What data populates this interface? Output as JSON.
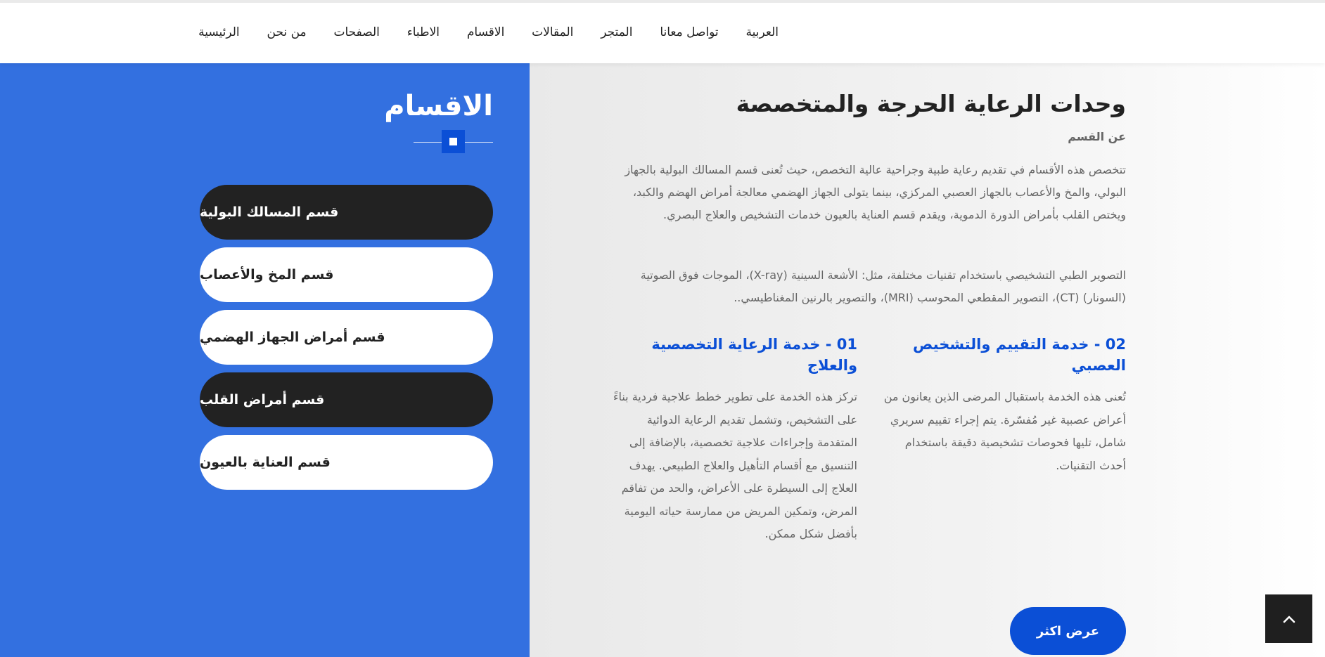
{
  "nav": {
    "items": [
      "الرئيسية",
      "من نحن",
      "الصفحات",
      "الاطباء",
      "الاقسام",
      "المقالات",
      "المتجر",
      "تواصل معانا",
      "العربية"
    ]
  },
  "sidebar": {
    "title": "الاقسام",
    "departments": [
      {
        "label": "قسم المسالك البولية",
        "style": "dark"
      },
      {
        "label": "قسم المخ والأعصاب",
        "style": "light"
      },
      {
        "label": "قسم أمراض الجهاز الهضمي",
        "style": "light"
      },
      {
        "label": "قسم أمراض القلب",
        "style": "dark"
      },
      {
        "label": "قسم العناية بالعيون",
        "style": "light"
      }
    ]
  },
  "main": {
    "title": "وحدات الرعاية الحرجة والمتخصصة",
    "subtitle": "عن القسم",
    "paragraph1": "تتخصص هذه الأقسام في تقديم رعاية طبية وجراحية عالية التخصص، حيث تُعنى قسم المسالك البولية بالجهاز البولي، والمخ والأعصاب بالجهاز العصبي المركزي، بينما يتولى الجهاز الهضمي معالجة أمراض الهضم والكبد، ويختص القلب بأمراض الدورة الدموية، ويقدم قسم العناية بالعيون خدمات التشخيص والعلاج البصري.",
    "paragraph2": "التصوير الطبي التشخيصي باستخدام تقنيات مختلفة، مثل: الأشعة السينية (X-ray)، الموجات فوق الصوتية (السونار) (CT)، التصوير المقطعي المحوسب (MRI)، والتصوير بالرنين المغناطيسي..",
    "services": [
      {
        "title": "02 - خدمة التقييم والتشخيص العصبي",
        "text": "تُعنى هذه الخدمة باستقبال المرضى الذين يعانون من أعراض عصبية غير مُفسّرة. يتم إجراء تقييم سريري شامل، تليها فحوصات تشخيصية دقيقة باستخدام أحدث التقنيات."
      },
      {
        "title": "01 - خدمة الرعاية التخصصية والعلاج",
        "text": "تركز هذه الخدمة على تطوير خطط علاجية فردية بناءً على التشخيص، وتشمل تقديم الرعاية الدوائية المتقدمة وإجراءات علاجية تخصصية، بالإضافة إلى التنسيق مع أقسام التأهيل والعلاج الطبيعي. يهدف العلاج إلى السيطرة على الأعراض، والحد من تفاقم المرض، وتمكين المريض من ممارسة حياته اليومية بأفضل شكل ممكن."
      }
    ],
    "more_button": "عرض اكثر"
  },
  "colors": {
    "sidebar_bg": "#3370e0",
    "accent_blue": "#0b4fd6",
    "dark_pill": "#222222"
  },
  "icons": {
    "back_to_top": "chevron-up-icon",
    "title_ornament": "square-ornament-icon"
  }
}
